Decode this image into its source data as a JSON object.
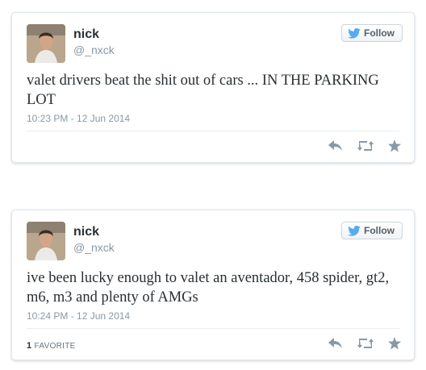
{
  "tweets": [
    {
      "name": "nick",
      "handle": "@_nxck",
      "follow_label": "Follow",
      "text": "valet drivers beat the shit out of cars ... IN THE PARKING LOT",
      "timestamp": "10:23 PM - 12 Jun 2014",
      "favorites_count": "",
      "favorites_label": ""
    },
    {
      "name": "nick",
      "handle": "@_nxck",
      "follow_label": "Follow",
      "text": "ive been lucky enough to valet an aventador, 458 spider, gt2, m6, m3 and plenty of AMGs",
      "timestamp": "10:24 PM - 12 Jun 2014",
      "favorites_count": "1",
      "favorites_label": "FAVORITE"
    }
  ],
  "icons": {
    "follow": "twitter-bird-icon",
    "reply": "reply-icon",
    "retweet": "retweet-icon",
    "favorite": "star-icon"
  },
  "colors": {
    "twitter_blue": "#55acee",
    "action_gray": "#8899a6",
    "text": "#292f33"
  }
}
